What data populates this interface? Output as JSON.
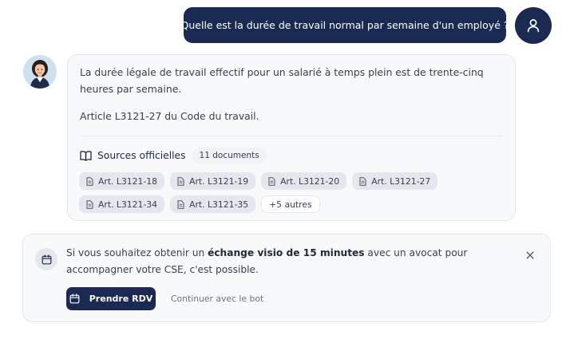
{
  "user_message": {
    "text": "Quelle est la durée de travail normal par semaine d'un employé ?",
    "avatar_icon": "user-icon"
  },
  "bot_message": {
    "avatar_icon": "assistant-avatar",
    "answer": "La durée légale de travail effectif pour un salarié à temps plein est de trente-cinq heures par semaine.",
    "reference": "Article L3121-27 du Code du travail.",
    "sources": {
      "icon": "book-icon",
      "title": "Sources officielles",
      "count": "11 documents",
      "chip_icon": "document-icon",
      "chips": [
        "Art. L3121-18",
        "Art. L3121-19",
        "Art. L3121-20",
        "Art. L3121-27",
        "Art. L3121-34",
        "Art. L3121-35"
      ],
      "more": "+5 autres"
    }
  },
  "promo": {
    "icon": "calendar-icon",
    "text_before": "Si vous souhaitez obtenir un ",
    "text_bold": "échange visio de 15 minutes",
    "text_after": " avec un avocat pour accompagner votre CSE, c'est possible.",
    "close_icon": "close-icon",
    "primary_button": "Prendre RDV",
    "secondary_link": "Continuer avec le bot"
  },
  "colors": {
    "navy": "#1a2a52",
    "card_bg": "#f8f9fb",
    "chip_bg": "#e4e7ed",
    "border": "#e3e7ec"
  }
}
